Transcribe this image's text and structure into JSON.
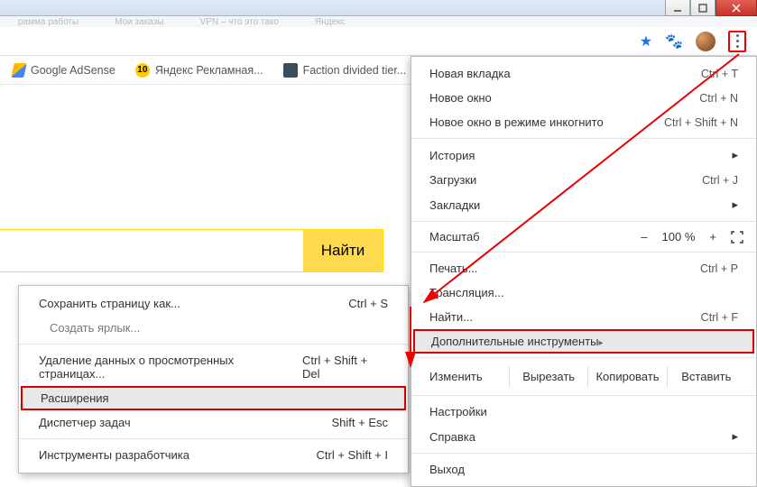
{
  "tabs": {
    "t1": "рамма работы",
    "t2": "Мои заказы",
    "t3": "VPN – что это тако",
    "t4": "Яндекс"
  },
  "bookmarks": {
    "adsense": "Google AdSense",
    "yandex_ad": "Яндекс Рекламная...",
    "yandex_badge": "10",
    "faction": "Faction divided tier..."
  },
  "search": {
    "button": "Найти"
  },
  "menu": {
    "new_tab": "Новая вкладка",
    "new_tab_sc": "Ctrl + T",
    "new_window": "Новое окно",
    "new_window_sc": "Ctrl + N",
    "incognito": "Новое окно в режиме инкогнито",
    "incognito_sc": "Ctrl + Shift + N",
    "history": "История",
    "downloads": "Загрузки",
    "downloads_sc": "Ctrl + J",
    "bookmarks": "Закладки",
    "zoom": "Масштаб",
    "zoom_minus": "–",
    "zoom_val": "100 %",
    "zoom_plus": "+",
    "print": "Печать...",
    "print_sc": "Ctrl + P",
    "cast": "Трансляция...",
    "find": "Найти...",
    "find_sc": "Ctrl + F",
    "more_tools": "Дополнительные инструменты",
    "edit": "Изменить",
    "cut": "Вырезать",
    "copy": "Копировать",
    "paste": "Вставить",
    "settings": "Настройки",
    "help": "Справка",
    "exit": "Выход"
  },
  "submenu": {
    "save_page": "Сохранить страницу как...",
    "save_page_sc": "Ctrl + S",
    "create_shortcut": "Создать ярлык...",
    "clear_data": "Удаление данных о просмотренных страницах...",
    "clear_data_sc": "Ctrl + Shift + Del",
    "extensions": "Расширения",
    "task_mgr": "Диспетчер задач",
    "task_mgr_sc": "Shift + Esc",
    "dev_tools": "Инструменты разработчика",
    "dev_tools_sc": "Ctrl + Shift + I"
  }
}
